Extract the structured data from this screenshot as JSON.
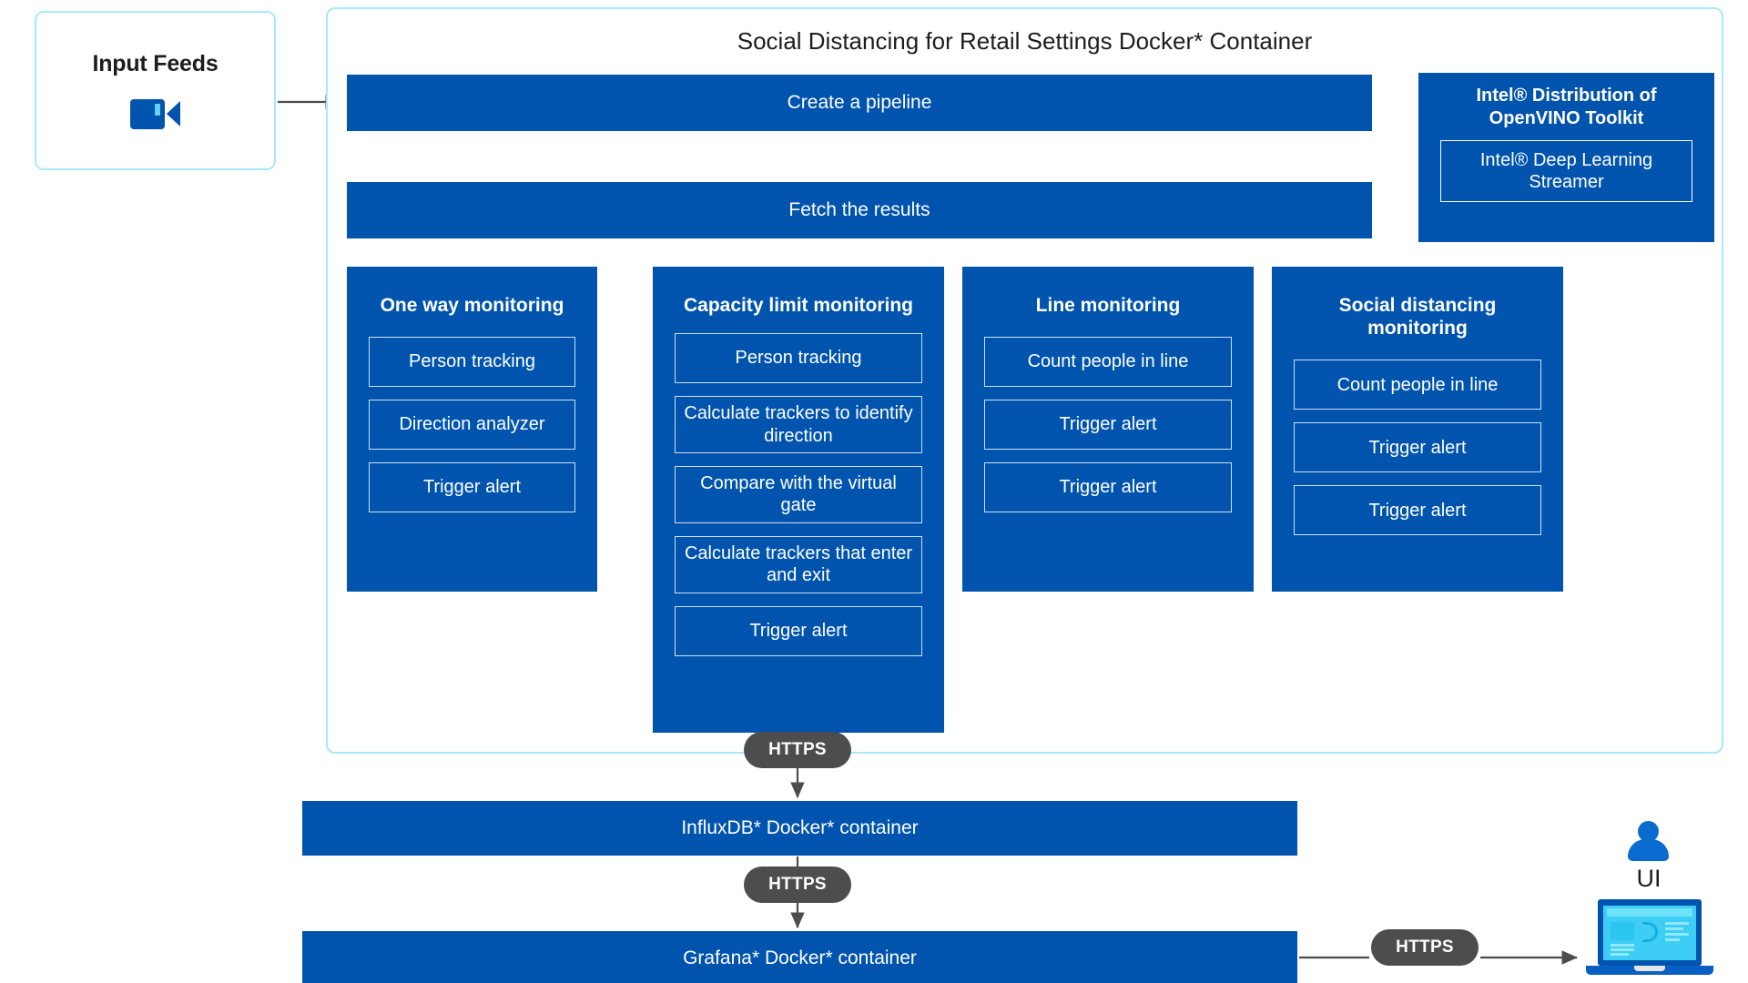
{
  "input_feeds": {
    "title": "Input Feeds",
    "icon": "video-camera-icon"
  },
  "main_container": {
    "title": "Social Distancing for Retail Settings Docker* Container",
    "bars": {
      "create_pipeline": "Create a pipeline",
      "fetch_results": "Fetch the results"
    },
    "openvino": {
      "title": "Intel® Distribution of OpenVINO Toolkit",
      "inner": "Intel® Deep Learning Streamer"
    },
    "columns": [
      {
        "title": "One way monitoring",
        "steps": [
          "Person tracking",
          "Direction analyzer",
          "Trigger alert"
        ]
      },
      {
        "title": "Capacity limit monitoring",
        "steps": [
          "Person tracking",
          "Calculate trackers to identify direction",
          "Compare with the virtual gate",
          "Calculate trackers that enter and exit",
          "Trigger alert"
        ]
      },
      {
        "title": "Line monitoring",
        "steps": [
          "Count people in line",
          "Trigger alert",
          "Trigger alert"
        ]
      },
      {
        "title": "Social distancing monitoring",
        "steps": [
          "Count people in line",
          "Trigger alert",
          "Trigger alert"
        ]
      }
    ]
  },
  "bottom": {
    "influxdb": "InfluxDB* Docker* container",
    "grafana": "Grafana* Docker* container",
    "https_labels": [
      "HTTPS",
      "HTTPS",
      "HTTPS"
    ]
  },
  "ui": {
    "label": "UI",
    "person_icon": "user-icon",
    "device_icon": "laptop-dashboard-icon"
  },
  "colors": {
    "brand_blue": "#0054ae",
    "accent_cyan": "#a9e7fb",
    "badge_gray": "#4d4d4d",
    "screen_cyan": "#3ecdf5",
    "arrow_gray": "#4d4d4d"
  }
}
